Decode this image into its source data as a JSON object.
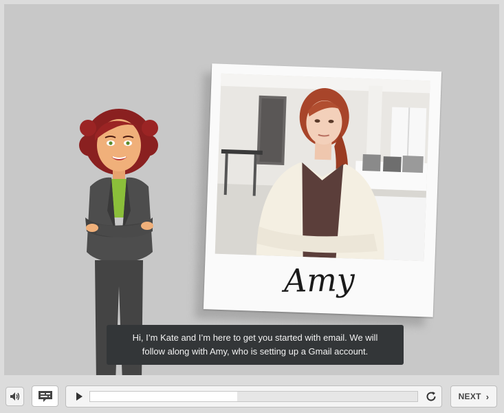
{
  "slide": {
    "photo_signature": "Amy",
    "caption": "Hi, I’m Kate and I’m here to get you started with email. We will follow along with Amy, who is setting up a Gmail account."
  },
  "player": {
    "next_label": "NEXT",
    "progress": 0.45,
    "icons": [
      "volume-icon",
      "captions-icon",
      "play-icon",
      "replay-icon",
      "chevron-right-icon"
    ]
  },
  "colors": {
    "stage": "#c8c8c8",
    "caption_bg": "#333638",
    "bar_bg": "#dcdcdc"
  }
}
